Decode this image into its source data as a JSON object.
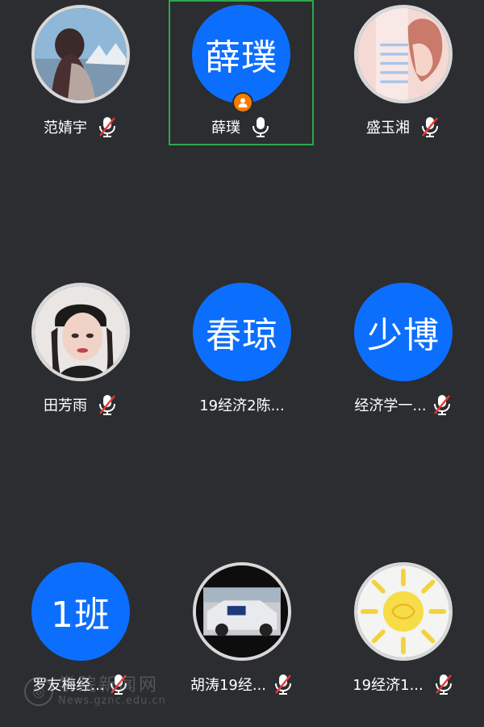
{
  "participants": [
    {
      "name": "范婧宇",
      "avatar_type": "photo",
      "avatar_icon": "girl-photo-icon",
      "mic": "muted"
    },
    {
      "name": "薛璞",
      "avatar_type": "text",
      "avatar_text": "薛璞",
      "mic": "on",
      "is_host": true,
      "active_speaker": true
    },
    {
      "name": "盛玉湘",
      "avatar_type": "photo",
      "avatar_icon": "anime-photo-icon",
      "mic": "muted"
    },
    {
      "name": "田芳雨",
      "avatar_type": "photo",
      "avatar_icon": "portrait-photo-icon",
      "mic": "muted"
    },
    {
      "name": "19经济2陈...",
      "avatar_type": "text",
      "avatar_text": "春琼",
      "mic": "none"
    },
    {
      "name": "经济学一...",
      "avatar_type": "text",
      "avatar_text": "少博",
      "mic": "muted"
    },
    {
      "name": "罗友梅经...",
      "avatar_type": "text",
      "avatar_text": "1班",
      "mic": "muted"
    },
    {
      "name": "胡涛19经...",
      "avatar_type": "photo",
      "avatar_icon": "car-photo-icon",
      "mic": "muted"
    },
    {
      "name": "19经济1...",
      "avatar_type": "photo",
      "avatar_icon": "sun-drawing-icon",
      "mic": "muted"
    }
  ],
  "watermark": {
    "cn": "学院新闻网",
    "en": "News.gznc.edu.cn"
  },
  "colors": {
    "background": "#2b2d30",
    "avatar_blue": "#0c6efd",
    "active_border": "#2ea74b",
    "host_badge": "#f57c00",
    "mute_slash": "#e53935"
  }
}
